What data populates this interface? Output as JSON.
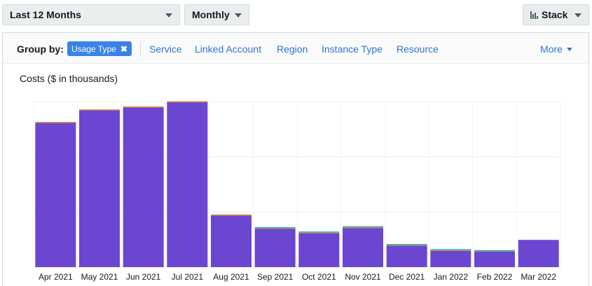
{
  "toolbar": {
    "range_label": "Last 12 Months",
    "granularity_label": "Monthly",
    "stack_label": "Stack"
  },
  "group_by": {
    "label": "Group by:",
    "selected": "Usage Type",
    "options": [
      "Service",
      "Linked Account",
      "Region",
      "Instance Type",
      "Resource"
    ],
    "more_label": "More"
  },
  "colors": {
    "primary_bar": "#6b46d1",
    "accent_top": "#d9822b",
    "accent_teal": "#2fb8c6",
    "link": "#2f73d3",
    "chip": "#3a83e6"
  },
  "chart_data": {
    "type": "bar",
    "stacked": true,
    "title": "Costs ($ in thousands)",
    "categories": [
      "Apr 2021",
      "May 2021",
      "Jun 2021",
      "Jul 2021",
      "Aug 2021",
      "Sep 2021",
      "Oct 2021",
      "Nov 2021",
      "Dec 2021",
      "Jan 2022",
      "Feb 2022",
      "Mar 2022"
    ],
    "series": [
      {
        "values": [
          196,
          213,
          217,
          224,
          70,
          52,
          46,
          53,
          29,
          22,
          21,
          37
        ]
      },
      {
        "values": [
          0.5,
          0.3,
          0.3,
          1.5,
          1.2,
          1.0,
          1.0,
          1.2,
          1.0,
          1.0,
          0.8,
          0
        ]
      },
      {
        "values": [
          0,
          0,
          0,
          0,
          0,
          0.5,
          0.8,
          0.5,
          0.8,
          0.3,
          0.8,
          0
        ]
      }
    ],
    "ylim": [
      0,
      225
    ],
    "grid": true
  }
}
